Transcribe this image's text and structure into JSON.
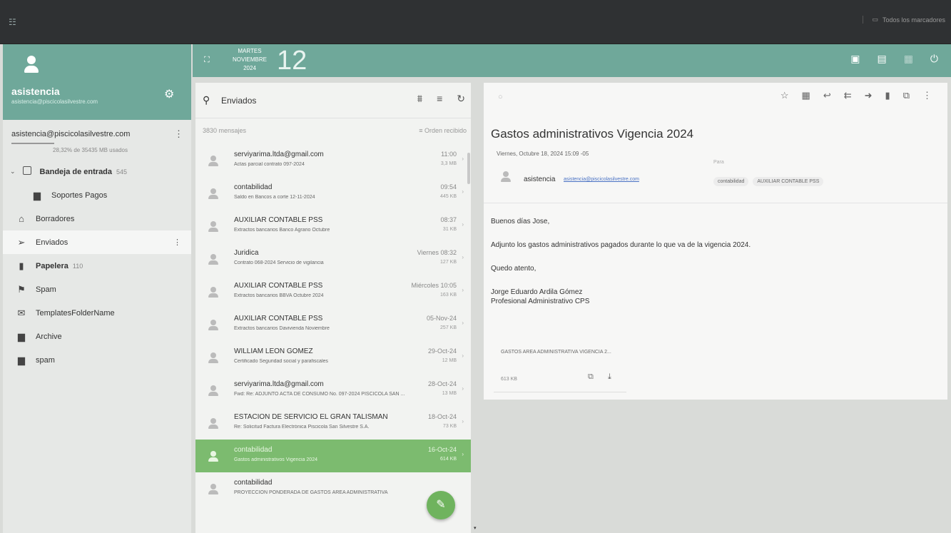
{
  "topbar": {
    "apps_icon": "grid-icon",
    "bookmarks_label": "Todos los marcadores"
  },
  "sidebar": {
    "account_name": "asistencia",
    "account_email": "asistencia@piscicolasilvestre.com",
    "account_address": "asistencia@piscicolasilvestre.com",
    "quota_text": "28,32% de 35435 MB usados",
    "folders": [
      {
        "label": "Bandeja de entrada",
        "count": "545",
        "icon": "inbox-icon"
      },
      {
        "label": "Soportes Pagos",
        "count": "",
        "icon": "folder-icon"
      },
      {
        "label": "Borradores",
        "count": "",
        "icon": "drafts-icon"
      },
      {
        "label": "Enviados",
        "count": "",
        "icon": "send-icon"
      },
      {
        "label": "Papelera",
        "count": "110",
        "icon": "trash-icon"
      },
      {
        "label": "Spam",
        "count": "",
        "icon": "spam-icon"
      },
      {
        "label": "TemplatesFolderName",
        "count": "",
        "icon": "template-icon"
      },
      {
        "label": "Archive",
        "count": "",
        "icon": "folder-icon"
      },
      {
        "label": "spam",
        "count": "",
        "icon": "folder-icon"
      }
    ]
  },
  "datebar": {
    "weekday": "MARTES",
    "month": "NOVIEMBRE",
    "year": "2024",
    "day": "12"
  },
  "list": {
    "folder_title": "Enviados",
    "count_text": "3830 mensajes",
    "order_text": "Orden recibido",
    "messages": [
      {
        "from": "serviyarima.ltda@gmail.com",
        "subject": "Actas parcial contrato 097-2024",
        "date": "11:00",
        "size": "3,3 MB"
      },
      {
        "from": "contabilidad",
        "subject": "Saldo en Bancos a corte 12-11-2024",
        "date": "09:54",
        "size": "445 KB"
      },
      {
        "from": "AUXILIAR CONTABLE PSS",
        "subject": "Extractos bancarios Banco Agrario Octubre",
        "date": "08:37",
        "size": "31 KB"
      },
      {
        "from": "Juridica",
        "subject": "Contrato 068-2024 Servicio de vigilancia",
        "date": "Viernes 08:32",
        "size": "127 KB"
      },
      {
        "from": "AUXILIAR CONTABLE PSS",
        "subject": "Extractos bancarios BBVA Octubre 2024",
        "date": "Miércoles 10:05",
        "size": "163 KB"
      },
      {
        "from": "AUXILIAR CONTABLE PSS",
        "subject": "Extractos bancarios Davivienda Noviembre",
        "date": "05-Nov-24",
        "size": "257 KB"
      },
      {
        "from": "WILLIAM LEON GOMEZ",
        "subject": "Certificado Seguridad social y parafiscales",
        "date": "29-Oct-24",
        "size": "12 MB"
      },
      {
        "from": "serviyarima.ltda@gmail.com",
        "subject": "Fwd: Re: ADJUNTO ACTA DE CONSUMO No. 097-2024 PISCICOLA SAN ...",
        "date": "28-Oct-24",
        "size": "13 MB"
      },
      {
        "from": "ESTACION DE SERVICIO EL GRAN TALISMAN",
        "subject": "Re: Solicitud Factura Electrónica Piscicola San Silvestre S.A.",
        "date": "18-Oct-24",
        "size": "73 KB"
      },
      {
        "from": "contabilidad",
        "subject": "Gastos administrativos Vigencia 2024",
        "date": "16-Oct-24",
        "size": "614 KB"
      },
      {
        "from": "contabilidad",
        "subject": "PROYECCIÓN PONDERADA DE GASTOS ÁREA ADMINISTRATIVA",
        "date": "",
        "size": ""
      }
    ]
  },
  "reader": {
    "subject": "Gastos administrativos Vigencia 2024",
    "sent": "Viernes, Octubre 18, 2024 15:09 -05",
    "from_name": "asistencia",
    "from_email": "asistencia@piscicolasilvestre.com",
    "to_label": "Para",
    "recipients": [
      "contabilidad",
      "AUXILIAR CONTABLE PSS"
    ],
    "body": {
      "greeting": "Buenos días Jose,",
      "line1": "Adjunto los gastos administrativos pagados durante lo que va de la vigencia 2024.",
      "closing": "Quedo atento,",
      "sig_name": "Jorge Eduardo Ardila Gómez",
      "sig_title": "Profesional Administrativo CPS"
    },
    "attachment": {
      "name": "GASTOS AREA ADMINISTRATIVA VIGENCIA 2...",
      "size": "613 KB"
    }
  }
}
